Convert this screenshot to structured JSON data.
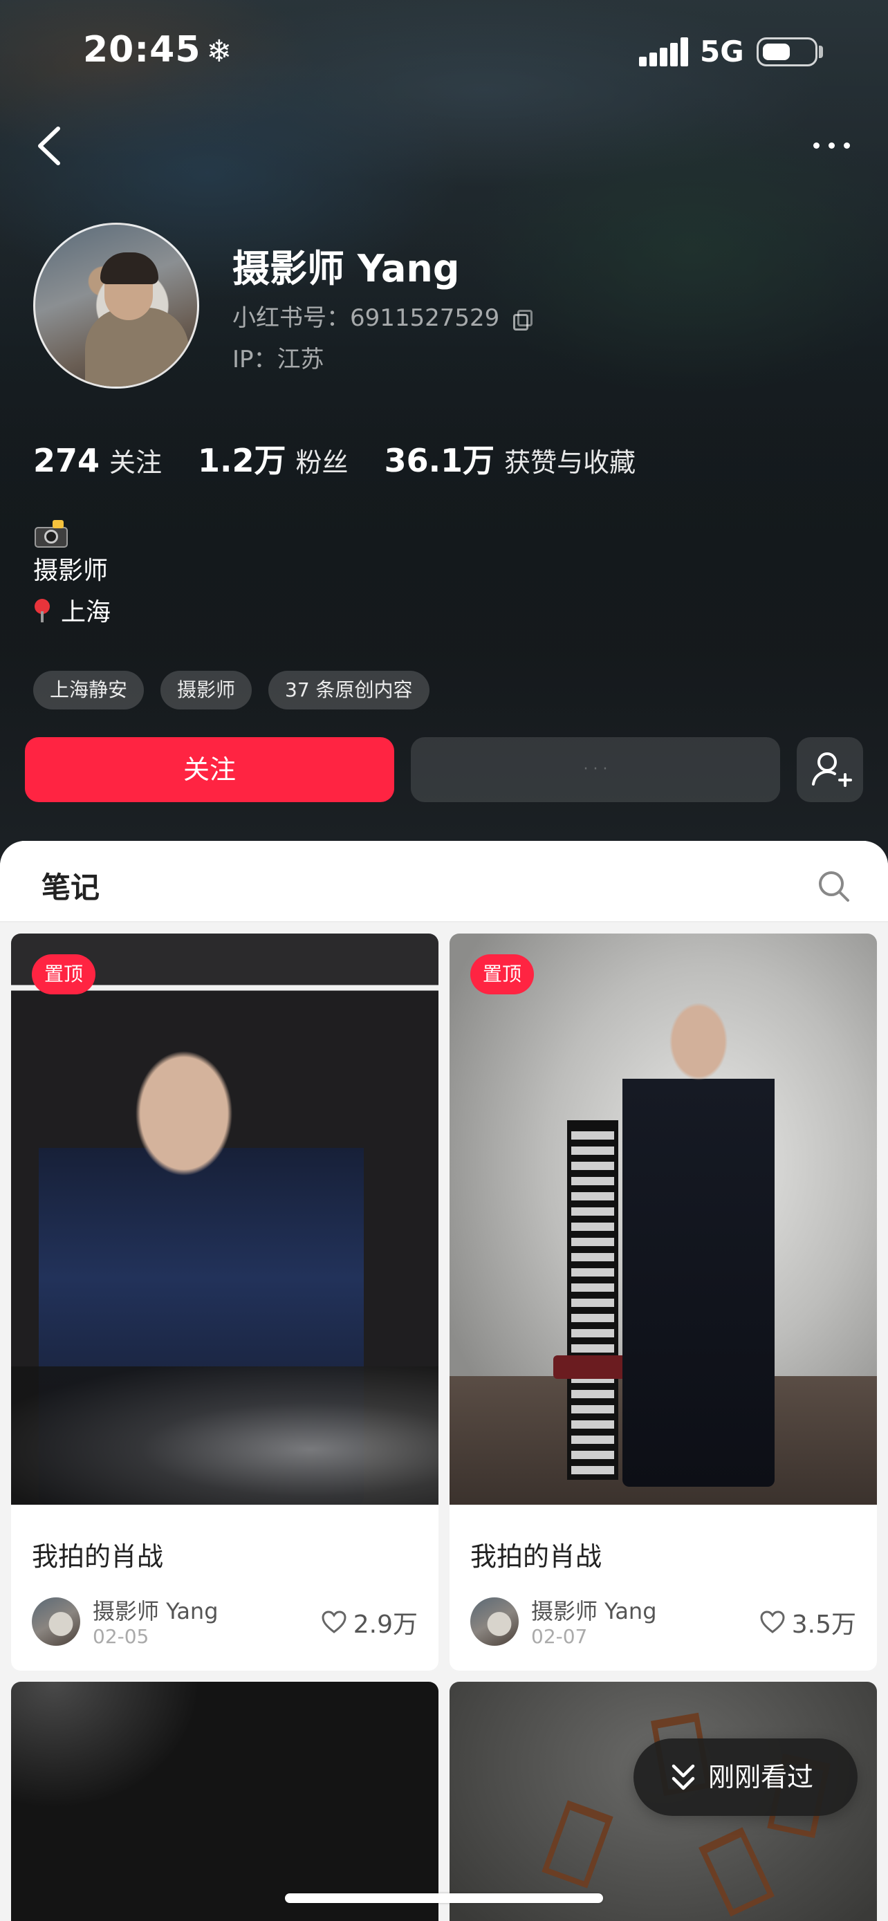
{
  "status_bar": {
    "time": "20:45",
    "weather_glyph": "❄",
    "network": "5G",
    "battery_level": 0.55
  },
  "nav": {
    "back_icon": "chevron-left-icon",
    "more_icon": "more-dots-icon"
  },
  "profile": {
    "name": "摄影师 Yang",
    "red_id": "小红书号：6911527529",
    "ip": "IP：江苏",
    "stats": [
      {
        "value": "274",
        "label": "关注"
      },
      {
        "value": "1.2万",
        "label": "粉丝"
      },
      {
        "value": "36.1万",
        "label": "获赞与收藏"
      }
    ],
    "bio": {
      "emoji_icon": "camera-flash-icon",
      "line1": "摄影师",
      "location": "上海"
    },
    "tags": [
      "上海静安",
      "摄影师",
      "37 条原创内容"
    ]
  },
  "actions": {
    "follow_label": "关注",
    "message_label": "· · ·",
    "add_friend_icon": "add-user-icon"
  },
  "colors": {
    "accent": "#ff2442",
    "header_bg": "#1c2125"
  },
  "notes_section": {
    "tab_label": "笔记",
    "search_icon": "search-icon",
    "cards": [
      {
        "badge": "置顶",
        "title": "我拍的肖战",
        "author": "摄影师 Yang",
        "date": "02-05",
        "likes": "2.9万"
      },
      {
        "badge": "置顶",
        "title": "我拍的肖战",
        "author": "摄影师 Yang",
        "date": "02-07",
        "likes": "3.5万"
      }
    ]
  },
  "floating": {
    "recent_label": "刚刚看过"
  }
}
